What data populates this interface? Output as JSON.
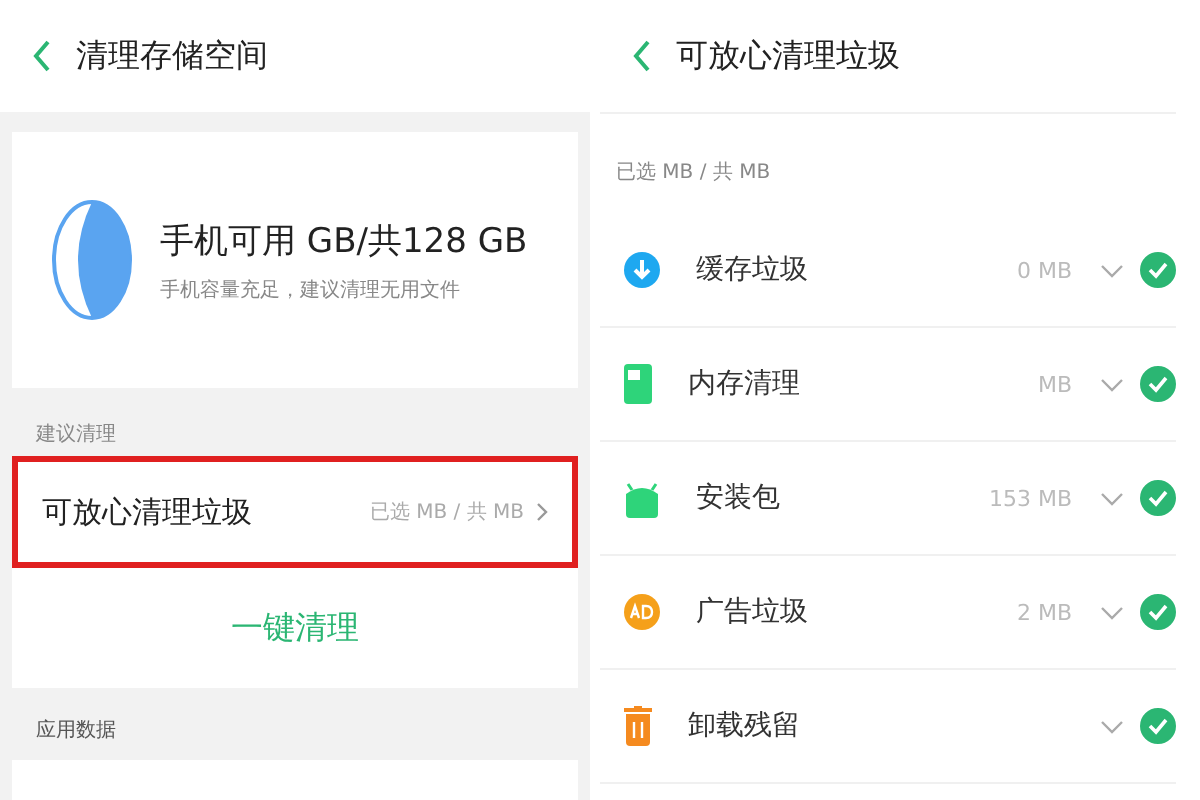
{
  "left": {
    "title": "清理存储空间",
    "storage": {
      "headline": "手机可用 GB/共128 GB",
      "subtitle": "手机容量充足，建议清理无用文件"
    },
    "section_label": "建议清理",
    "row": {
      "label": "可放心清理垃圾",
      "summary": "已选 MB / 共 MB",
      "highlighted": true
    },
    "clean_button": "一键清理",
    "section_label_2": "应用数据"
  },
  "right": {
    "title": "可放心清理垃圾",
    "summary": "已选 MB / 共 MB",
    "items": [
      {
        "kind": "cache",
        "label": "缓存垃圾",
        "size": "0 MB",
        "checked": true
      },
      {
        "kind": "memory",
        "label": "内存清理",
        "size": "MB",
        "checked": true
      },
      {
        "kind": "apk",
        "label": "安装包",
        "size": "153 MB",
        "checked": true
      },
      {
        "kind": "ad",
        "label": "广告垃圾",
        "size": "2 MB",
        "checked": true
      },
      {
        "kind": "residue",
        "label": "卸载残留",
        "checked": true
      }
    ]
  }
}
